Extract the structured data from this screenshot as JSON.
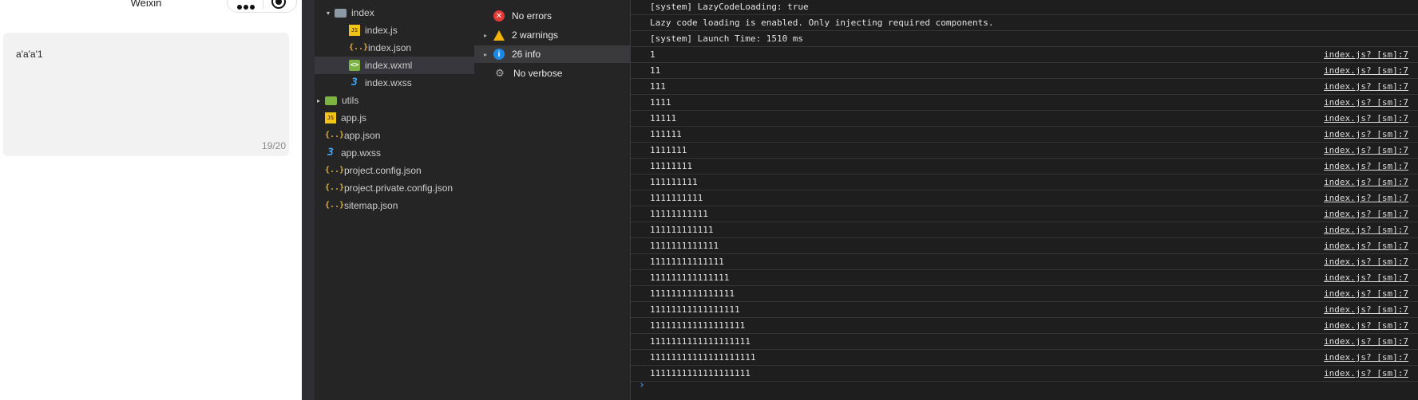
{
  "simulator": {
    "title": "Weixin",
    "textarea_value": "a'a'a'1",
    "textarea_count": "19/20"
  },
  "explorer": {
    "items": [
      {
        "label": "index",
        "icon": "folder-icon",
        "indent": 1,
        "arrow": "▾",
        "selected": false
      },
      {
        "label": "index.js",
        "icon": "js-file-icon",
        "indent": 2,
        "arrow": "",
        "selected": false
      },
      {
        "label": "index.json",
        "icon": "json-file-icon",
        "indent": 2,
        "arrow": "",
        "selected": false
      },
      {
        "label": "index.wxml",
        "icon": "wxml-file-icon",
        "indent": 2,
        "arrow": "",
        "selected": true
      },
      {
        "label": "index.wxss",
        "icon": "wxss-file-icon",
        "indent": 2,
        "arrow": "",
        "selected": false
      },
      {
        "label": "utils",
        "icon": "folder-icon",
        "indent": 0,
        "arrow": "▸",
        "selected": false
      },
      {
        "label": "app.js",
        "icon": "js-file-icon",
        "indent": 0,
        "arrow": "",
        "selected": false
      },
      {
        "label": "app.json",
        "icon": "json-file-icon",
        "indent": 0,
        "arrow": "",
        "selected": false
      },
      {
        "label": "app.wxss",
        "icon": "wxss-file-icon",
        "indent": 0,
        "arrow": "",
        "selected": false
      },
      {
        "label": "project.config.json",
        "icon": "json-file-icon",
        "indent": 0,
        "arrow": "",
        "selected": false
      },
      {
        "label": "project.private.config.json",
        "icon": "json-file-icon",
        "indent": 0,
        "arrow": "",
        "selected": false
      },
      {
        "label": "sitemap.json",
        "icon": "json-file-icon",
        "indent": 0,
        "arrow": "",
        "selected": false
      }
    ]
  },
  "filters": {
    "items": [
      {
        "label": "No errors",
        "icon": "error-icon",
        "arrow": false,
        "active": false
      },
      {
        "label": "2 warnings",
        "icon": "warning-icon",
        "arrow": true,
        "active": false
      },
      {
        "label": "26 info",
        "icon": "info-icon",
        "arrow": true,
        "active": true
      },
      {
        "label": "No verbose",
        "icon": "verbose-icon",
        "arrow": false,
        "active": false
      }
    ]
  },
  "console": {
    "system_lines": [
      "[system] LazyCodeLoading: true",
      "Lazy code loading is enabled. Only injecting required components.",
      "[system] Launch Time: 1510 ms"
    ],
    "log_lines": [
      {
        "text": "1",
        "source": "index.js? [sm]:7"
      },
      {
        "text": "11",
        "source": "index.js? [sm]:7"
      },
      {
        "text": "111",
        "source": "index.js? [sm]:7"
      },
      {
        "text": "1111",
        "source": "index.js? [sm]:7"
      },
      {
        "text": "11111",
        "source": "index.js? [sm]:7"
      },
      {
        "text": "111111",
        "source": "index.js? [sm]:7"
      },
      {
        "text": "1111111",
        "source": "index.js? [sm]:7"
      },
      {
        "text": "11111111",
        "source": "index.js? [sm]:7"
      },
      {
        "text": "111111111",
        "source": "index.js? [sm]:7"
      },
      {
        "text": "1111111111",
        "source": "index.js? [sm]:7"
      },
      {
        "text": "11111111111",
        "source": "index.js? [sm]:7"
      },
      {
        "text": "111111111111",
        "source": "index.js? [sm]:7"
      },
      {
        "text": "1111111111111",
        "source": "index.js? [sm]:7"
      },
      {
        "text": "11111111111111",
        "source": "index.js? [sm]:7"
      },
      {
        "text": "111111111111111",
        "source": "index.js? [sm]:7"
      },
      {
        "text": "1111111111111111",
        "source": "index.js? [sm]:7"
      },
      {
        "text": "11111111111111111",
        "source": "index.js? [sm]:7"
      },
      {
        "text": "111111111111111111",
        "source": "index.js? [sm]:7"
      },
      {
        "text": "1111111111111111111",
        "source": "index.js? [sm]:7"
      },
      {
        "text": "11111111111111111111",
        "source": "index.js? [sm]:7"
      },
      {
        "text": "1111111111111111111",
        "source": "index.js? [sm]:7"
      }
    ],
    "prompt_symbol": "›"
  }
}
